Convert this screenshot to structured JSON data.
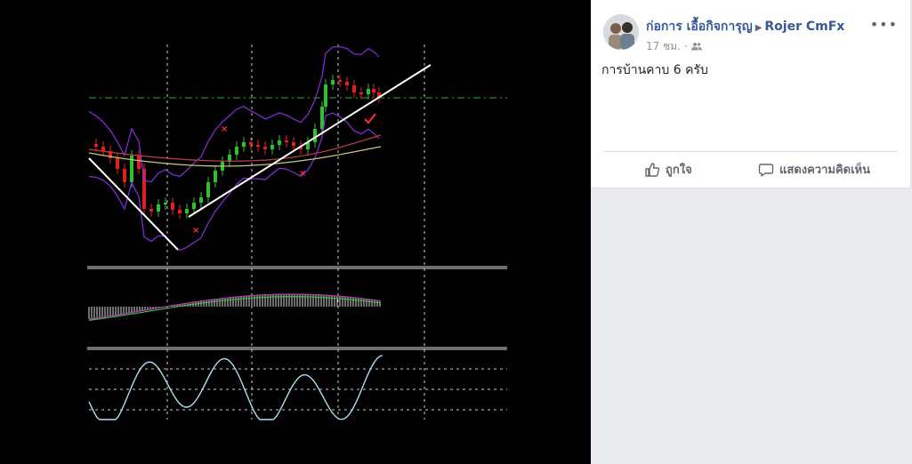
{
  "post": {
    "author": "ก่อการ เอื้อกิจการุญ",
    "target": "Rojer CmFx",
    "timestamp": "17 ชม.",
    "audience_icon": "group-icon",
    "more_icon": "•••",
    "text": "การบ้านคาบ 6 ครับ",
    "actions": {
      "like_label": "ถูกใจ",
      "like_icon": "thumbs-up-icon",
      "comment_label": "แสดงความคิดเห็น",
      "comment_icon": "comment-icon"
    }
  },
  "chart_colors": {
    "background": "#000000",
    "bull_candle": "#2fbf2f",
    "bear_candle": "#e02020",
    "bollinger": "#8a2be2",
    "trendline": "#ffffff",
    "resistance": "#2ea82e",
    "ma_fast": "#c8c878",
    "ma_slow": "#c04040",
    "macd_line": "#b040b0",
    "signal_line": "#40c040",
    "stochastic": "#a8e0f0",
    "grid": "#ffffff",
    "marker": "#ff3030"
  }
}
